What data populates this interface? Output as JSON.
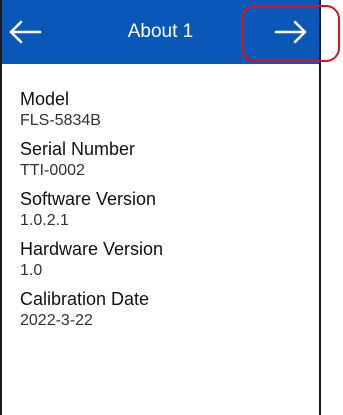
{
  "header": {
    "title": "About 1",
    "back_icon": "arrow-left-icon",
    "next_icon": "arrow-right-icon",
    "background_color": "#0a57b7",
    "highlight_color": "#d2161d"
  },
  "fields": [
    {
      "label": "Model",
      "value": "FLS-5834B"
    },
    {
      "label": "Serial Number",
      "value": "TTI-0002"
    },
    {
      "label": "Software Version",
      "value": "1.0.2.1"
    },
    {
      "label": "Hardware Version",
      "value": "1.0"
    },
    {
      "label": "Calibration Date",
      "value": "2022-3-22"
    }
  ]
}
